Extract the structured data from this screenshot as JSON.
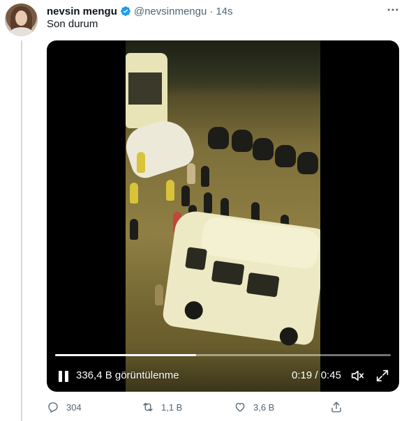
{
  "tweet": {
    "author_name": "nevsin mengu",
    "handle": "@nevsinmengu",
    "separator": "·",
    "time": "14s",
    "text": "Son durum",
    "more_icon": "more-horizontal-icon"
  },
  "video": {
    "views": "336,4 B görüntülenme",
    "time_current": "0:19",
    "time_separator": "/",
    "time_total": "0:45",
    "progress": 0.42,
    "icons": [
      "pause-icon",
      "mute-icon",
      "fullscreen-icon"
    ]
  },
  "actions": {
    "reply_count": "304",
    "retweet_count": "1,1 B",
    "like_count": "3,6 B",
    "icons": [
      "reply-icon",
      "retweet-icon",
      "like-icon",
      "share-icon"
    ]
  },
  "colors": {
    "verified_badge": "#1d9bf0",
    "secondary_text": "#536471",
    "thread_line": "#cfd9de"
  }
}
